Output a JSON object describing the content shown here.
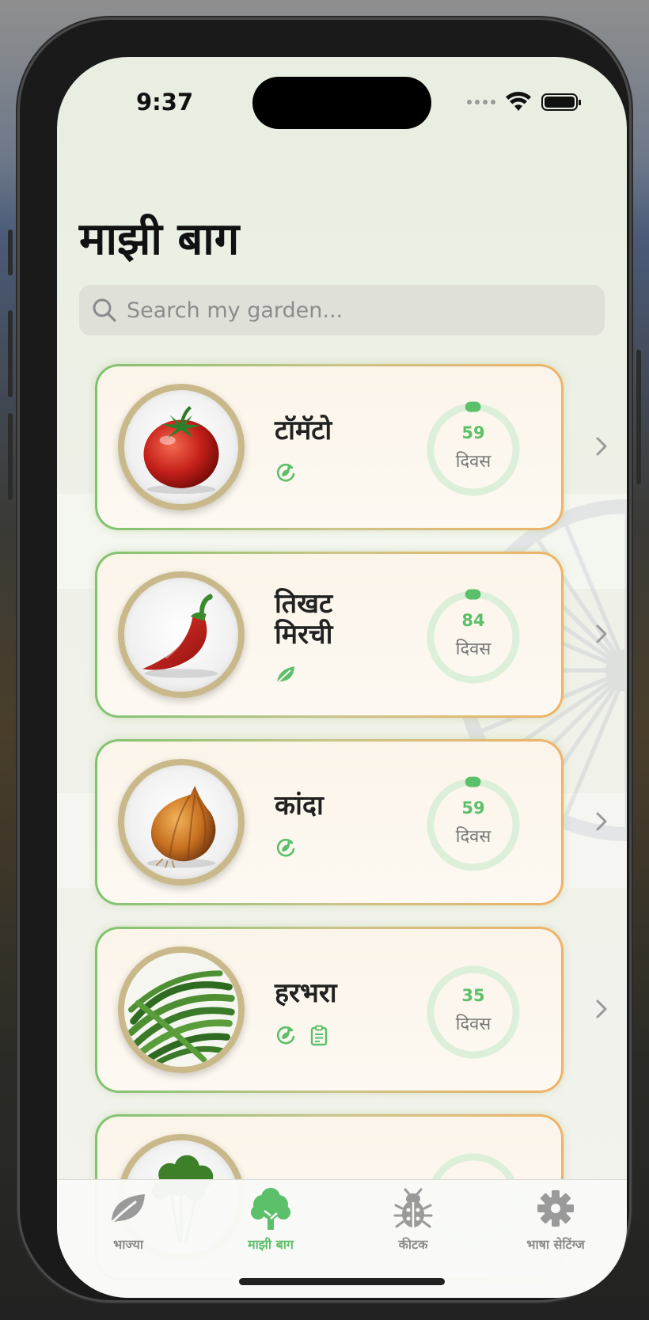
{
  "status": {
    "time": "9:37"
  },
  "title": "माझी बाग",
  "search": {
    "placeholder": "Search my garden...",
    "value": ""
  },
  "plants": [
    {
      "name": "टॉमॅटो",
      "days": "59",
      "unit": "दिवस",
      "progress": 0.02,
      "tags": [
        "rotate-icon"
      ]
    },
    {
      "name": "तिखट मिरची",
      "days": "84",
      "unit": "दिवस",
      "progress": 0.02,
      "tags": [
        "leaf-icon"
      ]
    },
    {
      "name": "कांदा",
      "days": "59",
      "unit": "दिवस",
      "progress": 0.02,
      "tags": [
        "rotate-icon"
      ]
    },
    {
      "name": "हरभरा",
      "days": "35",
      "unit": "दिवस",
      "progress": 0,
      "tags": [
        "rotate-icon",
        "clipboard-icon"
      ]
    },
    {
      "name": "",
      "days": "",
      "unit": "",
      "progress": 0,
      "tags": []
    }
  ],
  "tabs": [
    {
      "label": "भाज्या",
      "icon": "leaf-icon",
      "active": false
    },
    {
      "label": "माझी बाग",
      "icon": "tree-icon",
      "active": true
    },
    {
      "label": "कीटक",
      "icon": "bug-icon",
      "active": false
    },
    {
      "label": "भाषा सेटिंग्ज",
      "icon": "gear-icon",
      "active": false
    }
  ],
  "colors": {
    "accent": "#5cbf69",
    "card_border_start": "#7ec46f",
    "card_border_end": "#f0b267",
    "ring_track": "#dcefd9"
  }
}
